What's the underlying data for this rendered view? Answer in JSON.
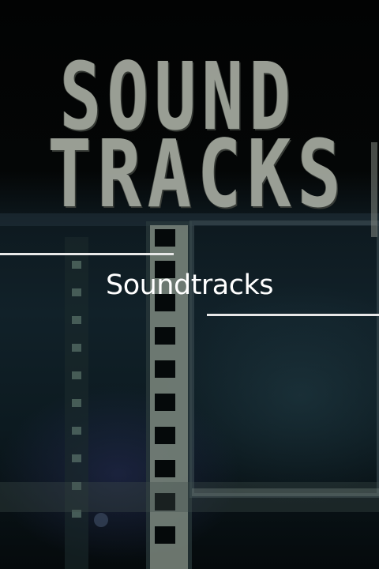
{
  "cover": {
    "line1": "SOUND",
    "line2": "TRACKS"
  },
  "title": "Soundtracks",
  "colors": {
    "background": "#0c1a20",
    "cover_text": "#a6aba1",
    "title_text": "#ffffff",
    "divider": "#e8e8e8"
  }
}
